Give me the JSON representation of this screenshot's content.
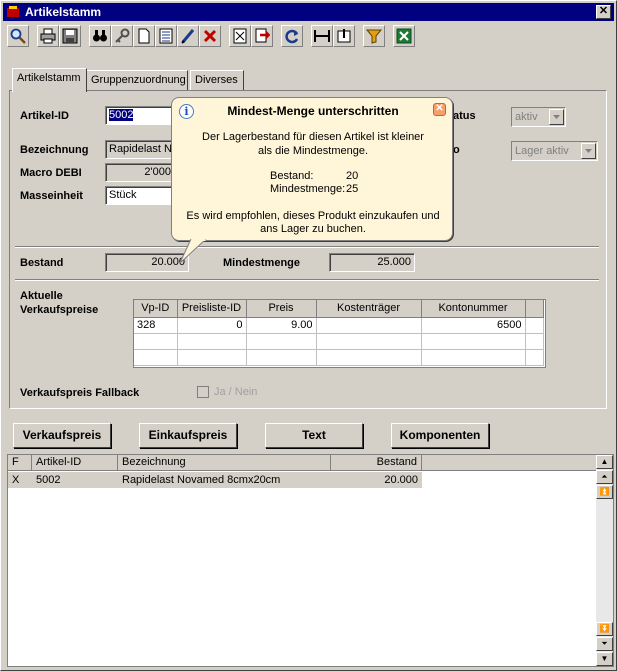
{
  "window": {
    "title": "Artikelstamm",
    "close_label": "✕"
  },
  "toolbar": {
    "icons": [
      "search-icon",
      "print-icon",
      "save-icon",
      "binoculars-icon",
      "key-icon",
      "new-document-icon",
      "list-icon",
      "edit-icon",
      "delete-icon",
      "calculator-icon",
      "export-icon",
      "refresh-icon",
      "expand-icon",
      "collapse-icon",
      "filter-icon",
      "excel-icon"
    ]
  },
  "tabs": [
    {
      "label": "Artikelstamm",
      "active": true
    },
    {
      "label": "Gruppenzuordnung",
      "active": false
    },
    {
      "label": "Diverses",
      "active": false
    }
  ],
  "form": {
    "artikel_id_label": "Artikel-ID",
    "artikel_id_value": "5002",
    "bezeichnung_label": "Bezeichnung",
    "bezeichnung_value": "Rapidelast No",
    "macro_debi_label": "Macro DEBI",
    "macro_debi_value": "2'000",
    "masseinheit_label": "Masseinheit",
    "masseinheit_value": "Stück",
    "status_label": "atus",
    "status_value": "aktiv",
    "lager_label": "o",
    "lager_value": "Lager aktiv",
    "bestand_label": "Bestand",
    "bestand_value": "20.000",
    "mindestmenge_label": "Mindestmenge",
    "mindestmenge_value": "25.000",
    "verkaufspreise_label_1": "Aktuelle",
    "verkaufspreise_label_2": "Verkaufspreise",
    "fallback_label": "Verkaufspreis Fallback",
    "fallback_checkbox_label": "Ja / Nein"
  },
  "price_grid": {
    "columns": [
      "Vp-ID",
      "Preisliste-ID",
      "Preis",
      "Kostenträger",
      "Kontonummer"
    ],
    "rows": [
      [
        "328",
        "0",
        "9.00",
        "",
        "6500"
      ]
    ]
  },
  "buttons": {
    "verkaufspreis": "Verkaufspreis",
    "einkaufspreis": "Einkaufspreis",
    "text": "Text",
    "komponenten": "Komponenten"
  },
  "list": {
    "columns": [
      "F",
      "Artikel-ID",
      "Bezeichnung",
      "Bestand"
    ],
    "rows": [
      [
        "X",
        "5002",
        "Rapidelast Novamed 8cmx20cm",
        "20.000"
      ]
    ]
  },
  "balloon": {
    "title": "Mindest-Menge unterschritten",
    "line1": "Der Lagerbestand für diesen Artikel ist kleiner",
    "line2": "als die Mindestmenge.",
    "bestand_label": "Bestand:",
    "bestand_value": "20",
    "mindest_label": "Mindestmenge:",
    "mindest_value": "25",
    "line3": "Es wird empfohlen, dieses Produkt einzukaufen und",
    "line4": "ans Lager zu buchen."
  }
}
